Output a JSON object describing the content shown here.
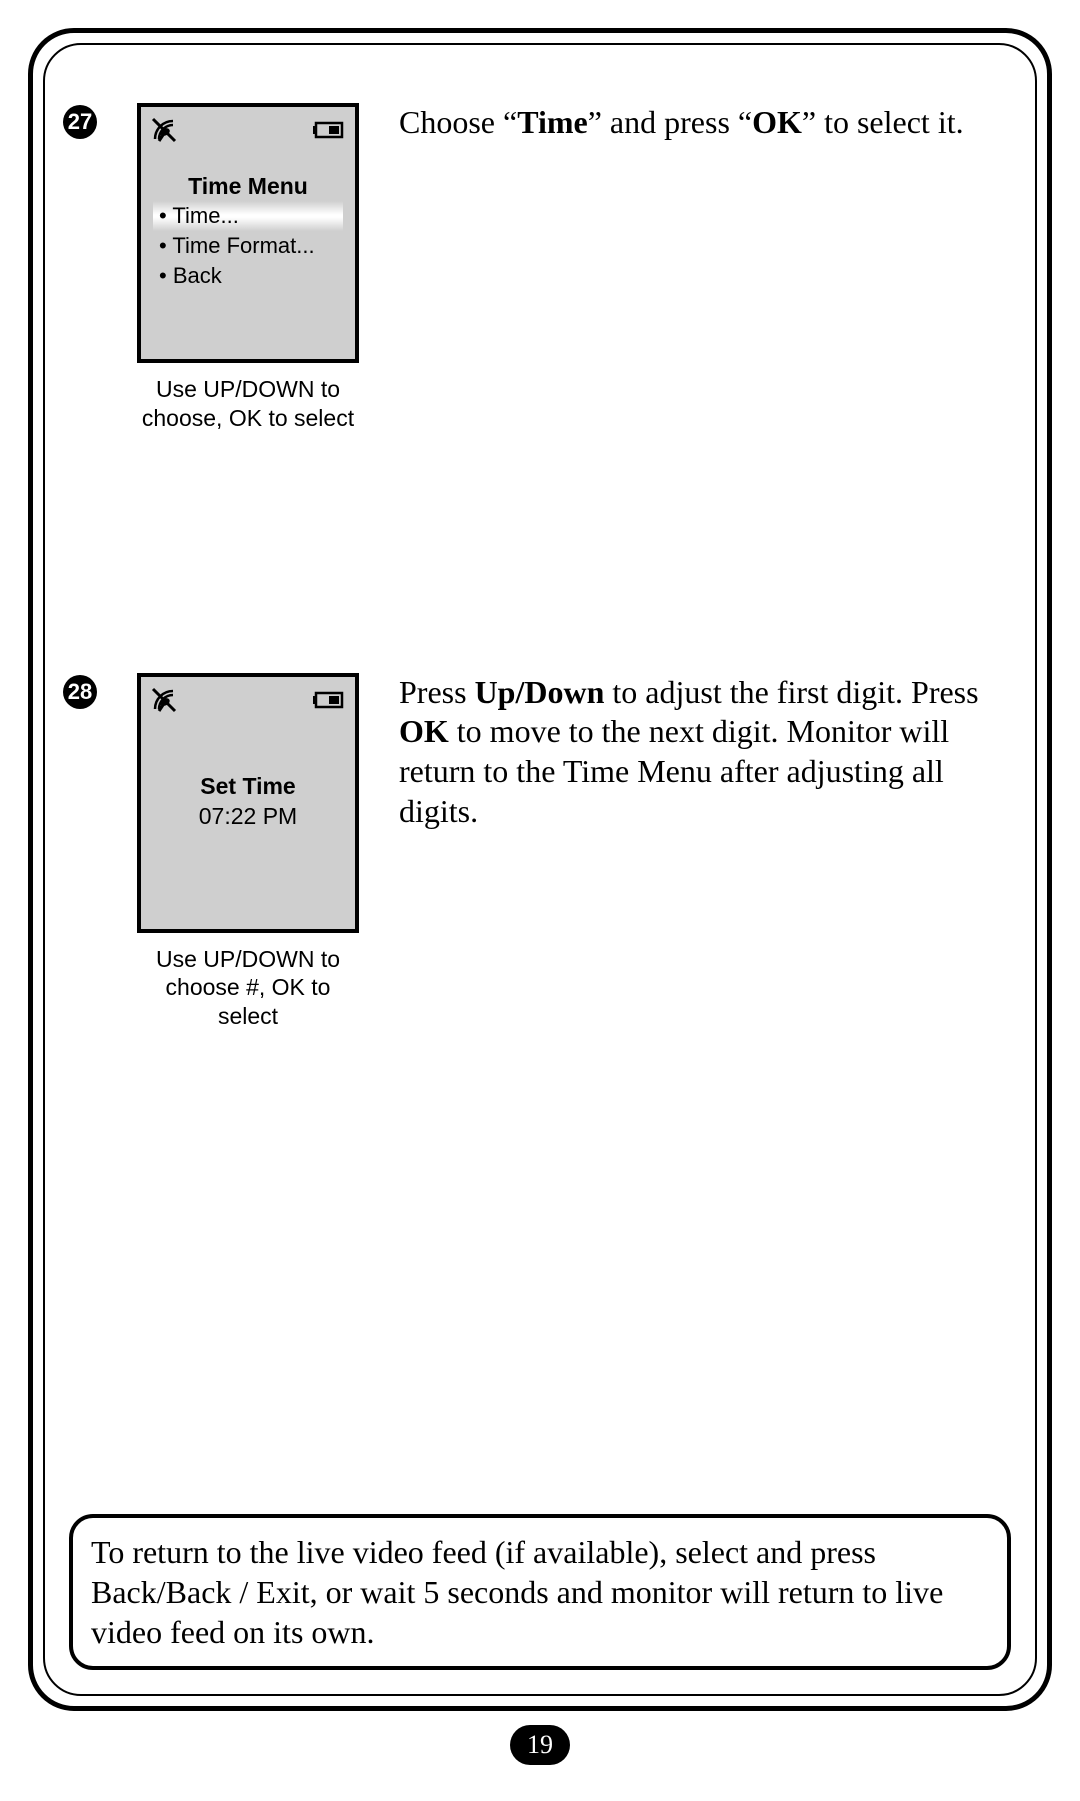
{
  "page_number": "19",
  "steps": [
    {
      "marker": "27",
      "screen": {
        "title": "Time Menu",
        "items": [
          {
            "label": "Time...",
            "highlight": true
          },
          {
            "label": "Time Format...",
            "highlight": false
          },
          {
            "label": "Back",
            "highlight": false
          }
        ]
      },
      "caption": "Use UP/DOWN to choose, OK to select",
      "instruction_parts": [
        {
          "t": "Choose “"
        },
        {
          "t": "Time",
          "bold": true
        },
        {
          "t": "” and press “"
        },
        {
          "t": "OK",
          "bold": true
        },
        {
          "t": "” to select it."
        }
      ]
    },
    {
      "marker": "28",
      "screen": {
        "set_time_title": "Set Time",
        "set_time_value": "07:22 PM"
      },
      "caption": "Use UP/DOWN to choose #, OK to select",
      "instruction_parts": [
        {
          "t": "Press "
        },
        {
          "t": "Up/Down",
          "bold": true
        },
        {
          "t": " to adjust the first digit. Press "
        },
        {
          "t": "OK",
          "bold": true
        },
        {
          "t": " to move to the next digit. Monitor will return to the Time Menu after adjusting all digits."
        }
      ]
    }
  ],
  "note": "To return to the live video feed (if available), select and press Back/Back / Exit, or wait 5 seconds and monitor will return to live video feed on its own."
}
